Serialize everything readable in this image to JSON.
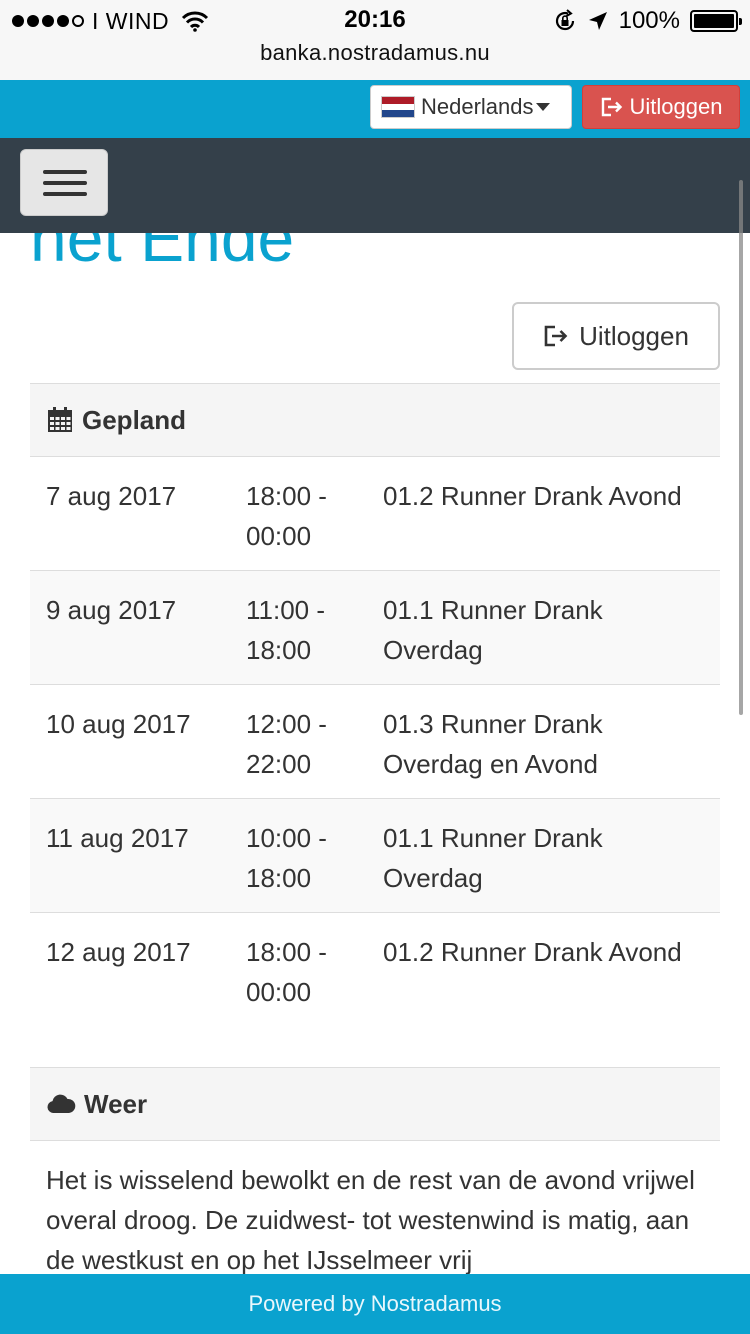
{
  "status_bar": {
    "carrier": "I WIND",
    "time": "20:16",
    "battery": "100%",
    "battery_level": 1.0,
    "signal_bars": 4
  },
  "browser": {
    "url": "banka.nostradamus.nu"
  },
  "topbar": {
    "language": "Nederlands",
    "logout_label": "Uitloggen"
  },
  "page": {
    "title": "het Ende",
    "logout_label": "Uitloggen"
  },
  "schedule": {
    "heading": "Gepland",
    "rows": [
      {
        "date": "7 aug 2017",
        "time": "18:00 - 00:00",
        "task": "01.2 Runner Drank Avond"
      },
      {
        "date": "9 aug 2017",
        "time": "11:00 - 18:00",
        "task": "01.1 Runner Drank Overdag"
      },
      {
        "date": "10 aug 2017",
        "time": "12:00 - 22:00",
        "task": "01.3 Runner Drank Overdag en Avond"
      },
      {
        "date": "11 aug 2017",
        "time": "10:00 - 18:00",
        "task": "01.1 Runner Drank Overdag"
      },
      {
        "date": "12 aug 2017",
        "time": "18:00 - 00:00",
        "task": "01.2 Runner Drank Avond"
      }
    ]
  },
  "weather": {
    "heading": "Weer",
    "text": "Het is wisselend bewolkt en de rest van de avond vrijwel overal droog. De zuidwest- tot westenwind is matig, aan de westkust en op het IJsselmeer vrij"
  },
  "footer": {
    "text": "Powered by Nostradamus"
  },
  "colors": {
    "accent": "#0aa2cf",
    "navbar": "#34404a",
    "danger": "#d9534f"
  }
}
